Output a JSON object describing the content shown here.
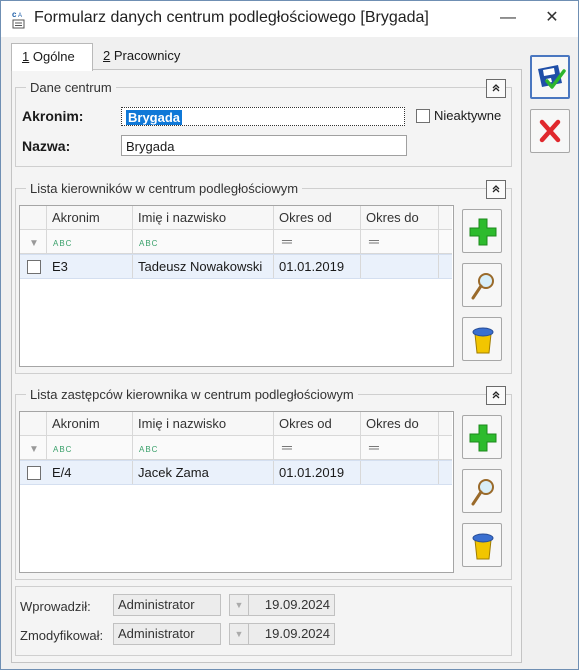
{
  "window": {
    "title": "Formularz danych centrum podległościowego [Brygada]",
    "minimize": "—",
    "close": "✕"
  },
  "tabs": [
    {
      "key": "1",
      "label": " Ogólne"
    },
    {
      "key": "2",
      "label": " Pracownicy"
    }
  ],
  "dane_centrum": {
    "legend": "Dane centrum",
    "akronim_label": "Akronim:",
    "akronim_value": "Brygada",
    "nazwa_label": "Nazwa:",
    "nazwa_value": "Brygada",
    "nieaktywne_label": "Nieaktywne"
  },
  "kierownicy": {
    "legend": "Lista kierowników w centrum podległościowym",
    "columns": [
      "Akronim",
      "Imię i nazwisko",
      "Okres od",
      "Okres do"
    ],
    "rows": [
      {
        "akronim": "E3",
        "imie": "Tadeusz Nowakowski",
        "od": "01.01.2019",
        "do": ""
      }
    ]
  },
  "zastepcy": {
    "legend": "Lista zastępców kierownika w centrum podległościowym",
    "columns": [
      "Akronim",
      "Imię i nazwisko",
      "Okres od",
      "Okres do"
    ],
    "rows": [
      {
        "akronim": "E/4",
        "imie": "Jacek Zama",
        "od": "01.01.2019",
        "do": ""
      }
    ]
  },
  "filter_symbols": {
    "abc": "ABC",
    "eq": "═"
  },
  "audit": {
    "wprowadzil_label": "Wprowadził:",
    "wprowadzil_user": "Administrator",
    "wprowadzil_date": "19.09.2024",
    "zmodyfikowal_label": "Zmodyfikował:",
    "zmodyfikowal_user": "Administrator",
    "zmodyfikowal_date": "19.09.2024"
  },
  "colors": {
    "selection": "#0f78d7",
    "add_green": "#2dbb2d",
    "delete_red": "#e0282d",
    "trash_yellow": "#f2c500",
    "trash_lid_blue": "#3a6fd0"
  }
}
